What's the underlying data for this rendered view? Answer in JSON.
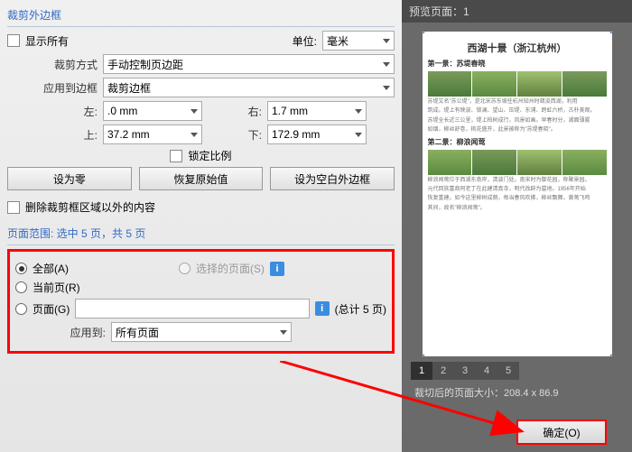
{
  "crop": {
    "header": "裁剪外边框",
    "showAll": "显示所有",
    "unit_lbl": "单位:",
    "unit_val": "毫米",
    "method_lbl": "裁剪方式",
    "method_val": "手动控制页边距",
    "applyBorder_lbl": "应用到边框",
    "applyBorder_val": "裁剪边框",
    "left_lbl": "左:",
    "left_val": ".0 mm",
    "right_lbl": "右:",
    "right_val": "1.7 mm",
    "top_lbl": "上:",
    "top_val": "37.2 mm",
    "bottom_lbl": "下:",
    "bottom_val": "172.9 mm",
    "lock": "锁定比例",
    "setZero": "设为零",
    "restore": "恢复原始值",
    "setBlank": "设为空白外边框",
    "deleteOutside": "删除裁剪框区域以外的内容"
  },
  "range": {
    "header": "页面范围: 选中 5 页，共 5 页",
    "all": "全部(A)",
    "selected": "选择的页面(S)",
    "current": "当前页(R)",
    "pages": "页面(G)",
    "total": "(总计 5 页)",
    "applyTo_lbl": "应用到:",
    "applyTo_val": "所有页面"
  },
  "preview": {
    "header": "预览页面：1",
    "doc_title": "西湖十景（浙江杭州）",
    "h1": "第一景：苏堤春晓",
    "h2": "第二景：柳浪闻莺",
    "pages": [
      "1",
      "2",
      "3",
      "4",
      "5"
    ],
    "after": "裁切后的页面大小：208.4 x 86.9"
  },
  "ok": "确定(O)"
}
